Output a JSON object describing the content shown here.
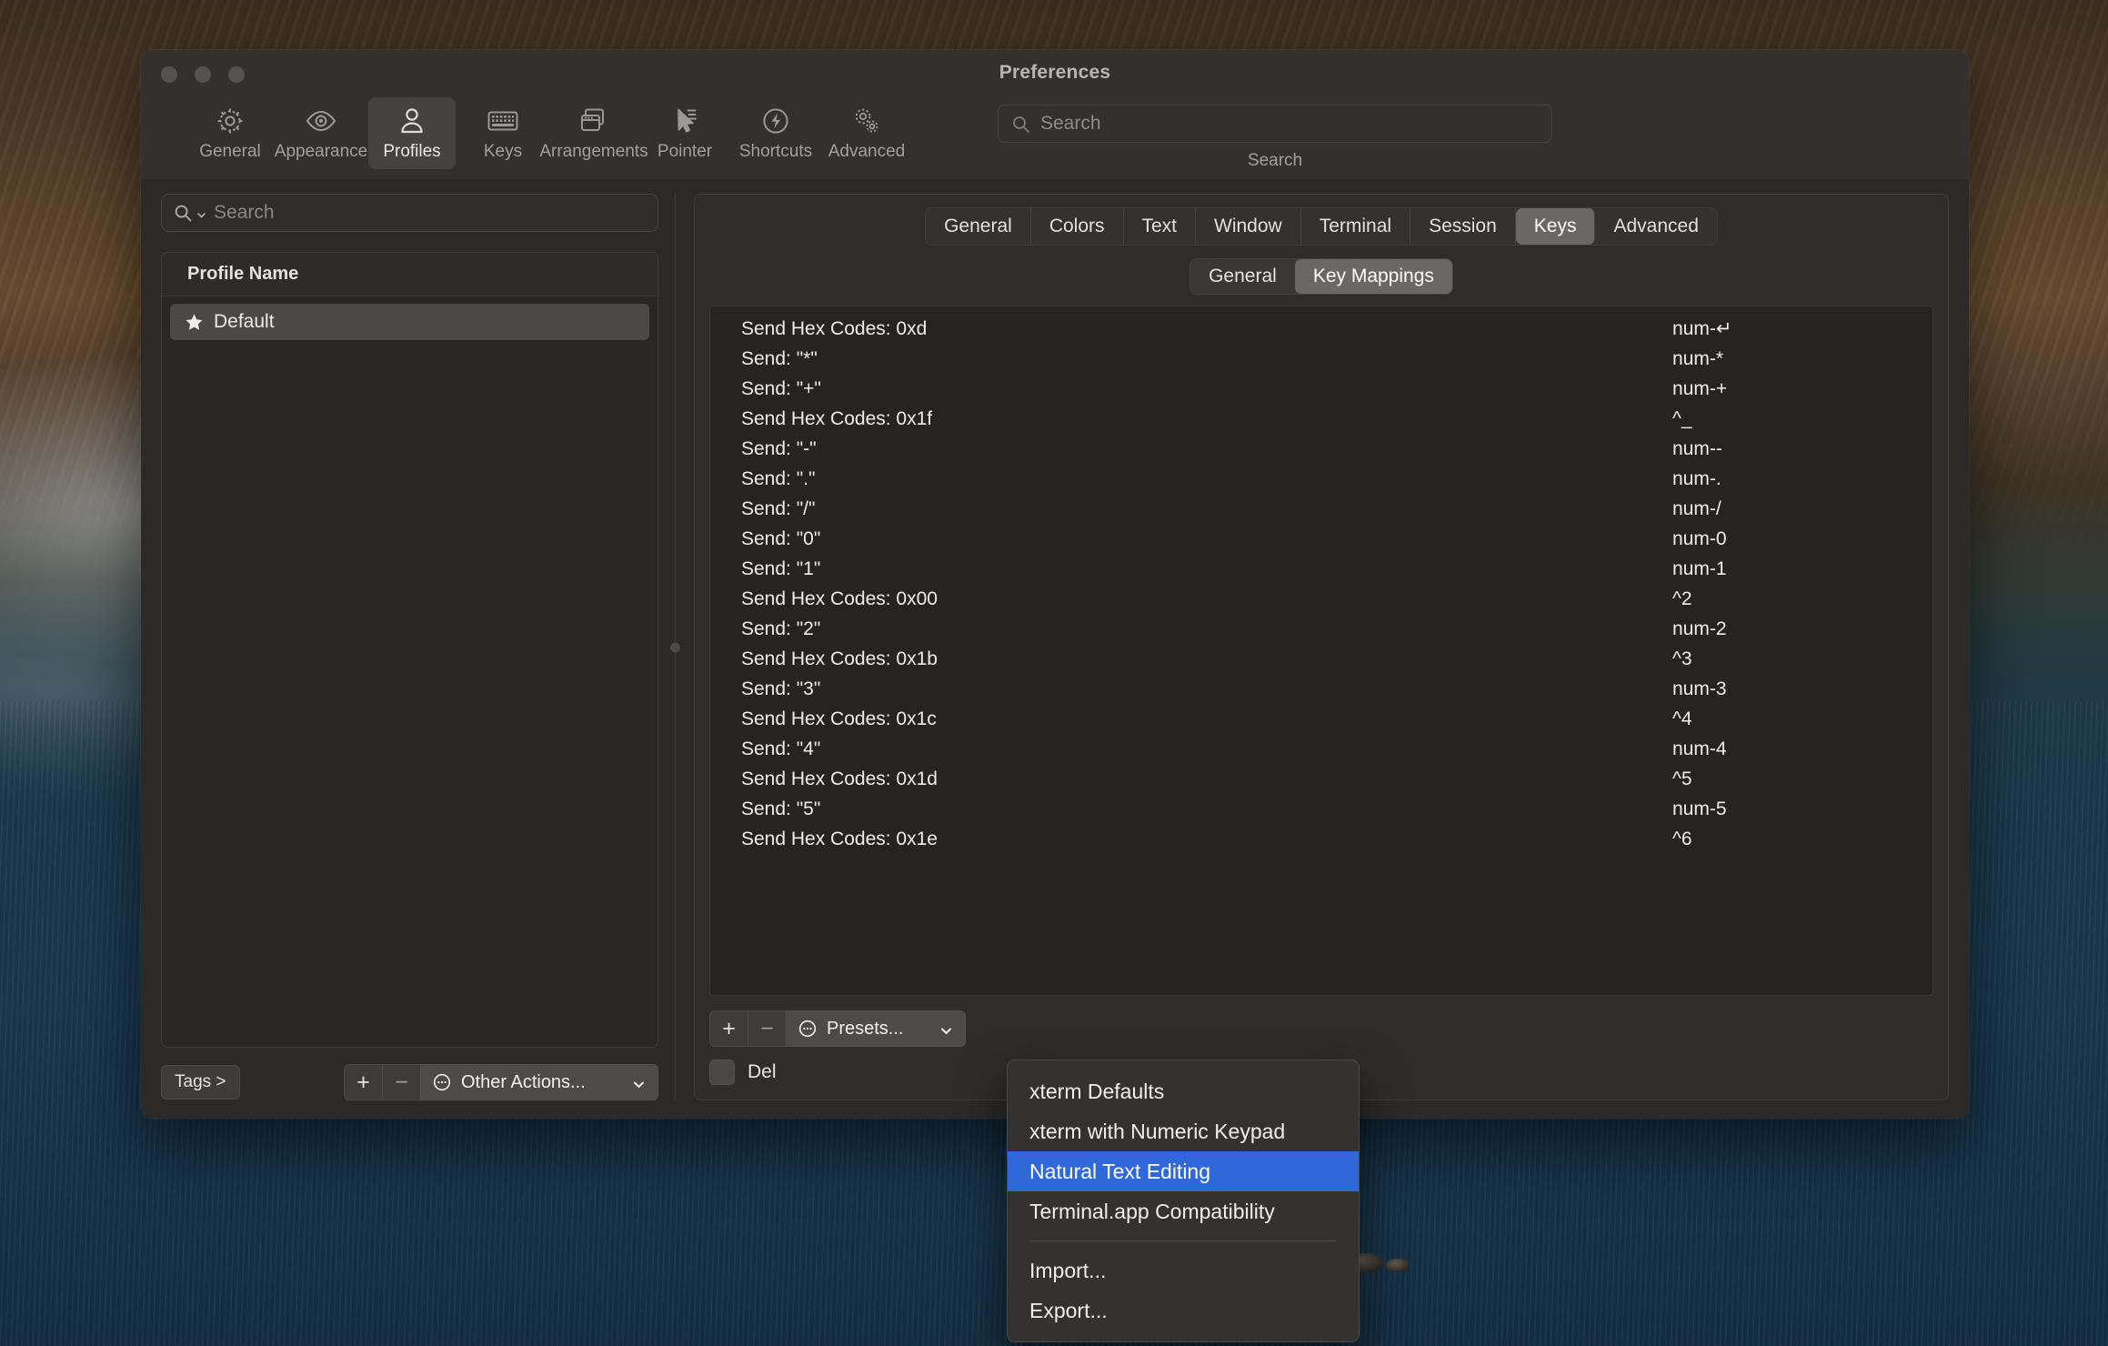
{
  "window": {
    "title": "Preferences",
    "traffic_lights": [
      "close-button",
      "minimize-button",
      "zoom-button"
    ]
  },
  "toolbar": {
    "items": [
      {
        "label": "General",
        "icon": "gear-icon",
        "selected": false
      },
      {
        "label": "Appearance",
        "icon": "eye-icon",
        "selected": false
      },
      {
        "label": "Profiles",
        "icon": "person-icon",
        "selected": true
      },
      {
        "label": "Keys",
        "icon": "keyboard-icon",
        "selected": false
      },
      {
        "label": "Arrangements",
        "icon": "windows-icon",
        "selected": false
      },
      {
        "label": "Pointer",
        "icon": "cursor-icon",
        "selected": false
      },
      {
        "label": "Shortcuts",
        "icon": "bolt-circle-icon",
        "selected": false
      },
      {
        "label": "Advanced",
        "icon": "gears-icon",
        "selected": false
      }
    ],
    "search": {
      "placeholder": "Search",
      "value": "",
      "caption": "Search",
      "icon": "search-icon"
    }
  },
  "sidebar": {
    "search": {
      "placeholder": "Search",
      "value": "",
      "icon": "search-icon"
    },
    "table": {
      "header": "Profile Name",
      "rows": [
        {
          "name": "Default",
          "icon": "star-icon",
          "selected": true
        }
      ]
    },
    "footer": {
      "tags_label": "Tags >",
      "add_label": "+",
      "remove_label": "−",
      "other_actions_label": "Other Actions...",
      "other_actions_icon": "ellipsis-circle-icon",
      "chevron_icon": "chevron-down-icon"
    }
  },
  "main": {
    "tabs": [
      {
        "label": "General",
        "active": false
      },
      {
        "label": "Colors",
        "active": false
      },
      {
        "label": "Text",
        "active": false
      },
      {
        "label": "Window",
        "active": false
      },
      {
        "label": "Terminal",
        "active": false
      },
      {
        "label": "Session",
        "active": false
      },
      {
        "label": "Keys",
        "active": true
      },
      {
        "label": "Advanced",
        "active": false
      }
    ],
    "subtabs": [
      {
        "label": "General",
        "active": false
      },
      {
        "label": "Key Mappings",
        "active": true
      }
    ],
    "key_mappings": [
      {
        "action": "Send Hex Codes: 0xd",
        "key": "num-↵"
      },
      {
        "action": "Send: \"*\"",
        "key": "num-*"
      },
      {
        "action": "Send: \"+\"",
        "key": "num-+"
      },
      {
        "action": "Send Hex Codes: 0x1f",
        "key": "^_"
      },
      {
        "action": "Send: \"-\"",
        "key": "num--"
      },
      {
        "action": "Send: \".\"",
        "key": "num-."
      },
      {
        "action": "Send: \"/\"",
        "key": "num-/"
      },
      {
        "action": "Send: \"0\"",
        "key": "num-0"
      },
      {
        "action": "Send: \"1\"",
        "key": "num-1"
      },
      {
        "action": "Send Hex Codes: 0x00",
        "key": "^2"
      },
      {
        "action": "Send: \"2\"",
        "key": "num-2"
      },
      {
        "action": "Send Hex Codes: 0x1b",
        "key": "^3"
      },
      {
        "action": "Send: \"3\"",
        "key": "num-3"
      },
      {
        "action": "Send Hex Codes: 0x1c",
        "key": "^4"
      },
      {
        "action": "Send: \"4\"",
        "key": "num-4"
      },
      {
        "action": "Send Hex Codes: 0x1d",
        "key": "^5"
      },
      {
        "action": "Send: \"5\"",
        "key": "num-5"
      },
      {
        "action": "Send Hex Codes: 0x1e",
        "key": "^6"
      }
    ],
    "footer": {
      "add_label": "+",
      "remove_label": "−",
      "presets_label": "Presets...",
      "presets_icon": "ellipsis-circle-icon",
      "chevron_icon": "chevron-down-icon",
      "checkbox_label": "Del",
      "checkbox_checked": false
    }
  },
  "presets_menu": {
    "items": [
      {
        "label": "xterm Defaults",
        "highlighted": false,
        "separator_after": false
      },
      {
        "label": "xterm with Numeric Keypad",
        "highlighted": false,
        "separator_after": false
      },
      {
        "label": "Natural Text Editing",
        "highlighted": true,
        "separator_after": false
      },
      {
        "label": "Terminal.app Compatibility",
        "highlighted": false,
        "separator_after": true
      },
      {
        "label": "Import...",
        "highlighted": false,
        "separator_after": false
      },
      {
        "label": "Export...",
        "highlighted": false,
        "separator_after": false
      }
    ]
  },
  "colors": {
    "window_bg": "#2b2a28",
    "titlebar_bg": "#323130",
    "table_bg": "#252423",
    "accent_highlight": "#2f68d8",
    "selected_row": "#4b4947",
    "text_primary": "#efedea",
    "text_secondary": "#a3a09c"
  }
}
